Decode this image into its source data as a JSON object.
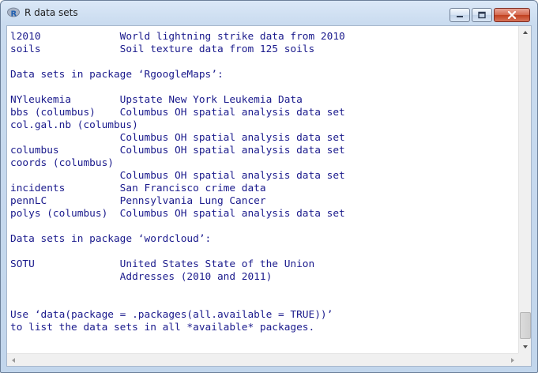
{
  "window": {
    "title": "R data sets",
    "icon": "r-logo-icon"
  },
  "console": {
    "lines": [
      "l2010             World lightning strike data from 2010",
      "soils             Soil texture data from 125 soils",
      "",
      "Data sets in package ‘RgoogleMaps’:",
      "",
      "NYleukemia        Upstate New York Leukemia Data",
      "bbs (columbus)    Columbus OH spatial analysis data set",
      "col.gal.nb (columbus)",
      "                  Columbus OH spatial analysis data set",
      "columbus          Columbus OH spatial analysis data set",
      "coords (columbus)",
      "                  Columbus OH spatial analysis data set",
      "incidents         San Francisco crime data",
      "pennLC            Pennsylvania Lung Cancer",
      "polys (columbus)  Columbus OH spatial analysis data set",
      "",
      "Data sets in package ‘wordcloud’:",
      "",
      "SOTU              United States State of the Union",
      "                  Addresses (2010 and 2011)",
      "",
      "",
      "Use ‘data(package = .packages(all.available = TRUE))’",
      "to list the data sets in all *available* packages."
    ]
  },
  "scrollbar": {
    "vertical_position": 0.95
  },
  "colors": {
    "text": "#1a1a8c",
    "close_button": "#c1401f"
  }
}
